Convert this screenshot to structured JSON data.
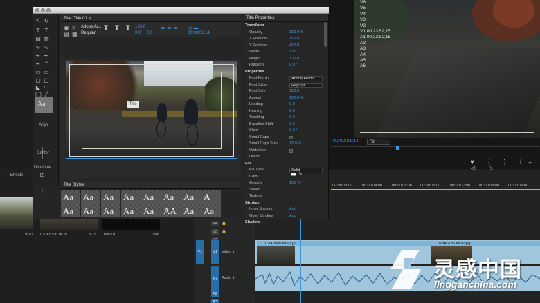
{
  "title_window": {
    "tab_label": "Title: Title 01",
    "close_symbol": "✕",
    "toolbar": {
      "font_family": "Adobe Ar...",
      "font_style": "Regular",
      "font_size": "120.0",
      "kerning": "0.0",
      "leading": "0.0",
      "timecode": "00:00:01:14"
    },
    "canvas": {
      "title_text": "Title"
    }
  },
  "tools": {
    "align_label": "Align",
    "center_label": "Center",
    "distribute_label": "Distribute",
    "style_preview": "Aa"
  },
  "title_styles": {
    "label": "Title Styles",
    "swatches": [
      "Aa",
      "Aa",
      "Aa",
      "Aa",
      "Aa",
      "Aa",
      "Aa",
      "A",
      "Aa",
      "Aa",
      "Aa",
      "Aa",
      "Aa",
      "AA",
      "Aa",
      "Aa"
    ]
  },
  "title_properties": {
    "header": "Title Properties",
    "rows": [
      {
        "k": "Transform",
        "type": "section"
      },
      {
        "k": "Opacity",
        "v": "100.0 %"
      },
      {
        "k": "X Position",
        "v": "700.0"
      },
      {
        "k": "Y Position",
        "v": "450.0"
      },
      {
        "k": "Width",
        "v": "137.7"
      },
      {
        "k": "Height",
        "v": "120.0"
      },
      {
        "k": "Rotation",
        "v": "0.0 °"
      },
      {
        "k": "Properties",
        "type": "section"
      },
      {
        "k": "Font Family",
        "v": "Adobe Arabic",
        "type": "dropdown"
      },
      {
        "k": "Font Style",
        "v": "Regular",
        "type": "dropdown"
      },
      {
        "k": "Font Size",
        "v": "120.0"
      },
      {
        "k": "Aspect",
        "v": "100.0 %"
      },
      {
        "k": "Leading",
        "v": "0.0"
      },
      {
        "k": "Kerning",
        "v": "0.0"
      },
      {
        "k": "Tracking",
        "v": "0.0"
      },
      {
        "k": "Baseline Shift",
        "v": "0.0"
      },
      {
        "k": "Slant",
        "v": "0.0 °"
      },
      {
        "k": "Small Caps",
        "v": "",
        "type": "check"
      },
      {
        "k": "Small Caps Size",
        "v": "75.0 %"
      },
      {
        "k": "Underline",
        "v": "",
        "type": "check"
      },
      {
        "k": "Distort",
        "v": ""
      },
      {
        "k": "Fill",
        "type": "section"
      },
      {
        "k": "Fill Type",
        "v": "Solid",
        "type": "dropdown"
      },
      {
        "k": "Color",
        "v": ""
      },
      {
        "k": "Opacity",
        "v": "100 %"
      },
      {
        "k": "Sheen",
        "v": ""
      },
      {
        "k": "Texture",
        "v": ""
      },
      {
        "k": "Strokes",
        "type": "section"
      },
      {
        "k": "Inner Strokes",
        "v": "Add"
      },
      {
        "k": "Outer Strokes",
        "v": "Add"
      },
      {
        "k": "Shadow",
        "type": "section"
      }
    ]
  },
  "program_monitor": {
    "tracks": [
      "V6",
      "V5",
      "V4",
      "V3",
      "V2",
      "V1 00;23;52;15",
      "A1 00;23;52;15",
      "A2",
      "A3",
      "A4",
      "A5",
      "A6"
    ],
    "timecode": "00:00:01:14",
    "fit": "Fit",
    "transport": "♥ { } {← ◁ ▷"
  },
  "timeline": {
    "timecodes": [
      "00:00:03:00",
      "00:00:04:00",
      "00:00:05:00",
      "00:00:06:00",
      "00:00:07:00",
      "00:00:08:00",
      "00:00:09:00"
    ],
    "tracks": [
      {
        "src": "",
        "tag": "V4"
      },
      {
        "src": "",
        "tag": "V3"
      },
      {
        "src": "",
        "tag": "V2"
      },
      {
        "src": "",
        "tag": "A2"
      },
      {
        "src": "",
        "tag": "A3"
      }
    ],
    "v1_src": "V1",
    "v1_tag": "V1",
    "v1_name": "Video 1",
    "a1_tag": "A1",
    "a1_name": "Audio 1",
    "clip1": "073A0585.MOV [V]",
    "clip2": "073A5736.MOV [V]"
  },
  "bin": {
    "effects_tab": "Effects",
    "captions": [
      "9:20",
      "073A5736.MOV",
      "3:23",
      "Title 01",
      "0:06"
    ]
  },
  "watermark": {
    "name": "灵感中国",
    "url": "lingganchina.com"
  }
}
